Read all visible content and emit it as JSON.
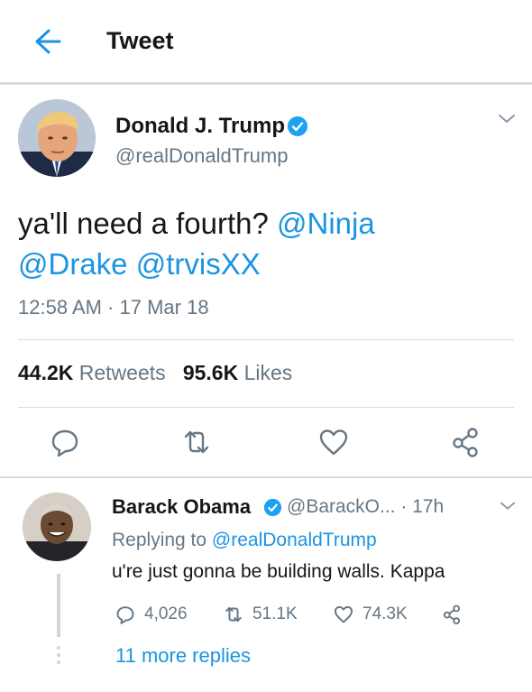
{
  "header": {
    "title": "Tweet",
    "back_icon": "arrow-left-icon"
  },
  "colors": {
    "accent": "#1b95e0",
    "secondary_text": "#657786",
    "primary_text": "#14171a",
    "verified": "#1da1f2"
  },
  "main_tweet": {
    "name": "Donald J. Trump",
    "handle": "@realDonaldTrump",
    "text_plain": "ya'll need a fourth? ",
    "mentions": [
      "@Ninja",
      "@Drake",
      "@trvisXX"
    ],
    "timestamp": "12:58 AM · 17 Mar 18",
    "retweets_count": "44.2K",
    "retweets_label": "Retweets",
    "likes_count": "95.6K",
    "likes_label": "Likes"
  },
  "reply": {
    "name": "Barack Obama",
    "handle": "@BarackO...",
    "time": "· 17h",
    "replying_prefix": "Replying to",
    "replying_handle": "@realDonaldTrump",
    "text": "u're just gonna be building walls. Kappa",
    "reply_count": "4,026",
    "retweet_count": "51.1K",
    "like_count": "74.3K"
  },
  "more_replies": "11 more replies"
}
